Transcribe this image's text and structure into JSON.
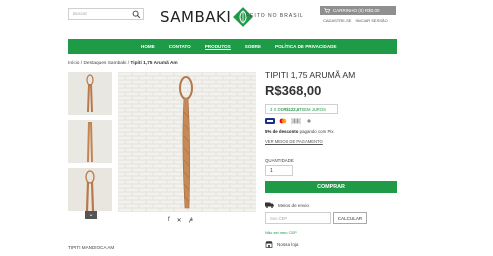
{
  "header": {
    "search_placeholder": "Buscar",
    "logo": "SAMBAKI",
    "tagline": "FEITO NO BRASIL",
    "cart_label": "CARRINHO (0) R$0,00",
    "register": "CADASTRE-SE",
    "login": "INICIAR SESSÃO"
  },
  "nav": {
    "items": [
      "HOME",
      "CONTATO",
      "PRODUTOS",
      "SOBRE",
      "POLÍTICA DE PRIVACIDADE"
    ],
    "active": "PRODUTOS"
  },
  "breadcrumb": {
    "home": "Início",
    "section": "Destaques Sambaki",
    "current": "Tipiti 1,75 Arumã Am"
  },
  "product": {
    "title": "TIPITI 1,75 ARUMÃ AM",
    "price": "R$368,00",
    "installments_prefix": "3 X DE ",
    "installments_value": "R$122,67",
    "installments_suffix": " SEM JUROS",
    "discount_bold": "5% de desconto",
    "discount_rest": " pagando com Pix",
    "payment_link": "VER MEIOS DE PAGAMENTO",
    "qty_label": "QUANTIDADE",
    "qty_value": "1",
    "buy_label": "COMPRAR",
    "shipping_label": "Meios de envio",
    "cep_placeholder": "Seu CEP",
    "calc_label": "CALCULAR",
    "no_cep": "Não sei meu CEP",
    "store_label": "Nossa loja",
    "description_title": "TIPITI MANDIOCA AM"
  },
  "share_icons": [
    "facebook-icon",
    "x-icon",
    "pinterest-icon"
  ],
  "colors": {
    "brand_green": "#1f9a47",
    "cart_gray": "#8f8f8f"
  }
}
